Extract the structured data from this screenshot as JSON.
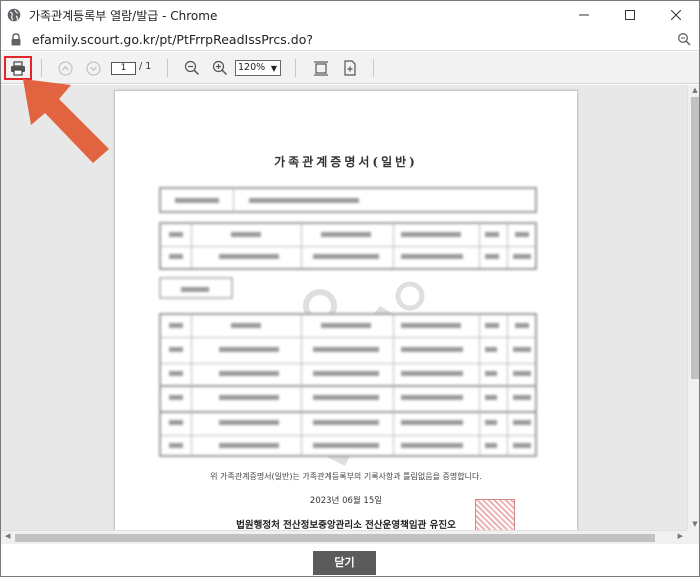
{
  "window": {
    "title": "가족관계등록부 열람/발급 - Chrome"
  },
  "address": {
    "url": "efamily.scourt.go.kr/pt/PtFrrpReadIssPrcs.do?"
  },
  "toolbar": {
    "current_page": "1",
    "page_total": "/ 1",
    "zoom_level": "120%",
    "zoom_arrow": "▼"
  },
  "document": {
    "title": "가족관계증명서(일반)",
    "certification_text": "위 가족관계증명서(일반)는 가족관계등록부의 기록사항과 틀림없음을 증명합니다.",
    "issue_date": "2023년 06월 15일",
    "issuer": "법원행정처 전산정보중앙관리소 전산운영책임관 유진오"
  },
  "footer": {
    "close_label": "닫기"
  },
  "colors": {
    "highlight": "#e3262e",
    "arrow": "#e2633f",
    "close_button": "#5b5b5b"
  },
  "icons": {
    "favicon": "globe-icon",
    "lock": "lock-icon",
    "zoom": "zoom-icon",
    "print": "print-icon",
    "prev_page": "chevron-up-icon",
    "next_page": "chevron-down-icon",
    "zoom_out": "zoom-out-icon",
    "zoom_in": "zoom-in-icon",
    "fit_page": "fit-page-icon",
    "add_page": "add-page-icon"
  }
}
